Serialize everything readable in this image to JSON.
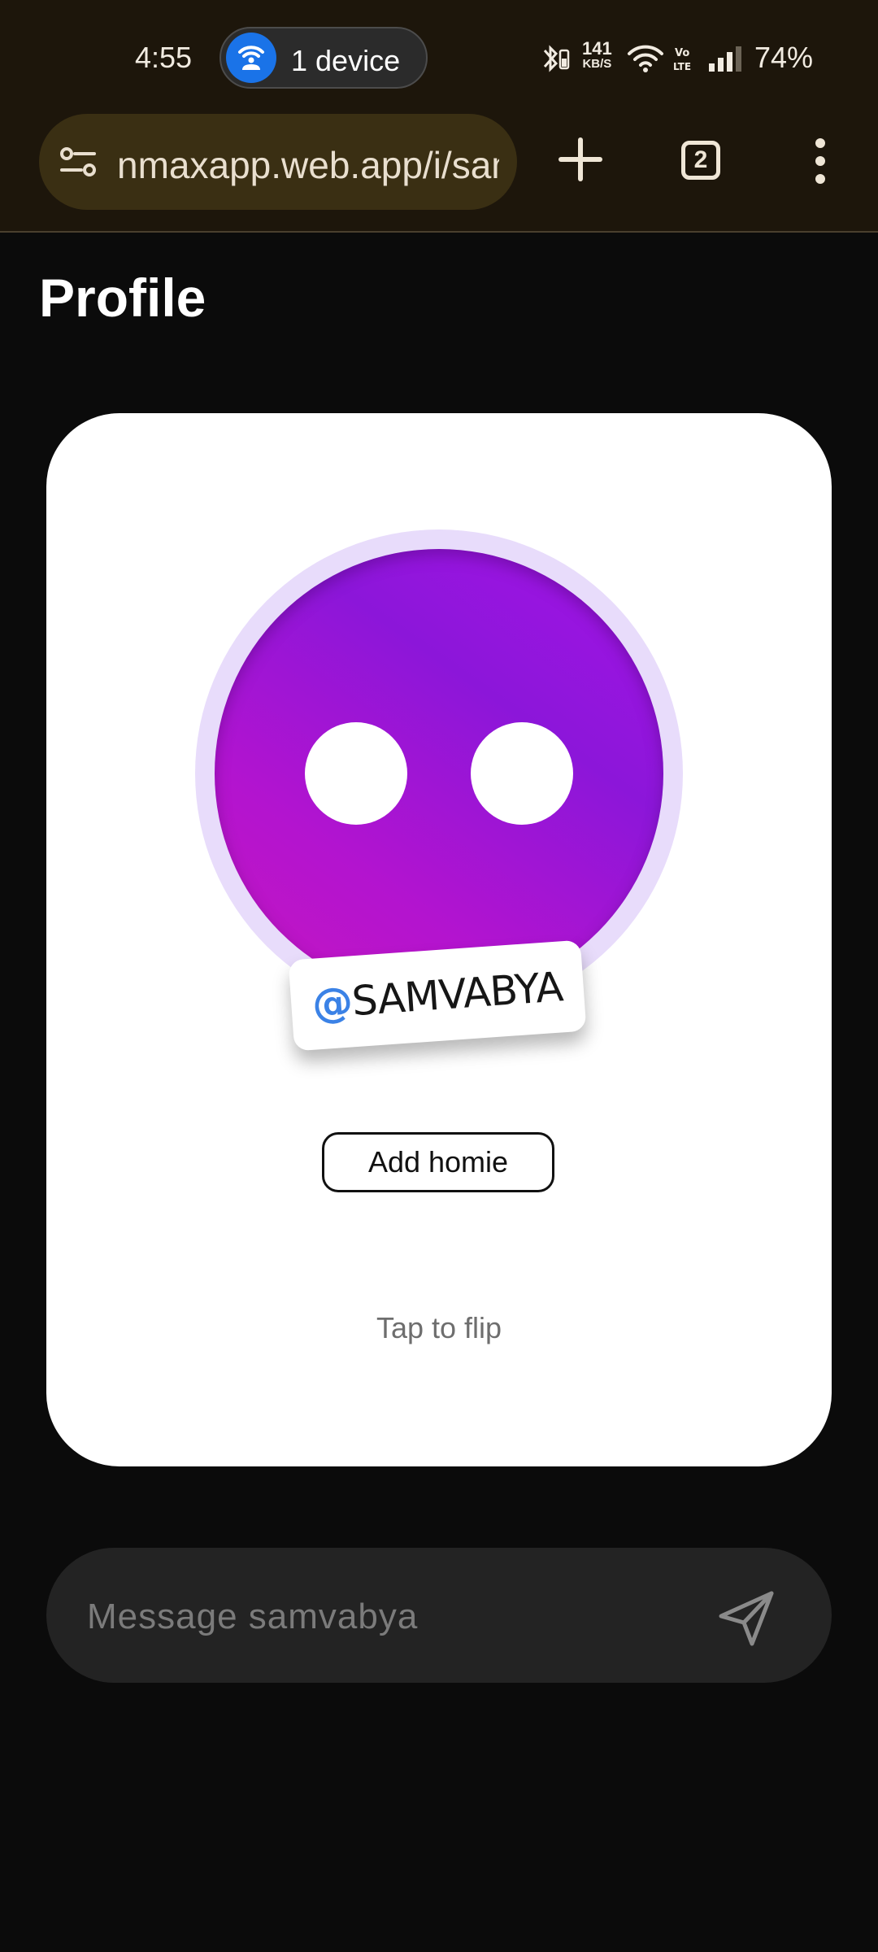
{
  "status_bar": {
    "time": "4:55",
    "hotspot_label": "1 device",
    "net_speed_value": "141",
    "net_speed_unit": "KB/S",
    "battery": "74%",
    "icons": [
      "bluetooth-battery-icon",
      "wifi-icon",
      "volte-icon",
      "signal-icon"
    ]
  },
  "browser": {
    "url": "nmaxapp.web.app/i/samvabya",
    "tab_count": "2",
    "icons": [
      "tune-icon",
      "plus-icon",
      "tabs-icon",
      "more-vert-icon"
    ]
  },
  "page": {
    "title": "Profile"
  },
  "profile_card": {
    "handle_prefix": "@",
    "handle": "SAMVABYA",
    "add_button_label": "Add homie",
    "flip_hint": "Tap to flip"
  },
  "message": {
    "placeholder": "Message samvabya",
    "send_icon": "send-icon"
  },
  "colors": {
    "avatar_gradient": [
      "#a314e6",
      "#c616c0"
    ],
    "handle_accent": "#3b82e6",
    "background": "#0b0b0b",
    "browser_bar": "#1d160b"
  }
}
